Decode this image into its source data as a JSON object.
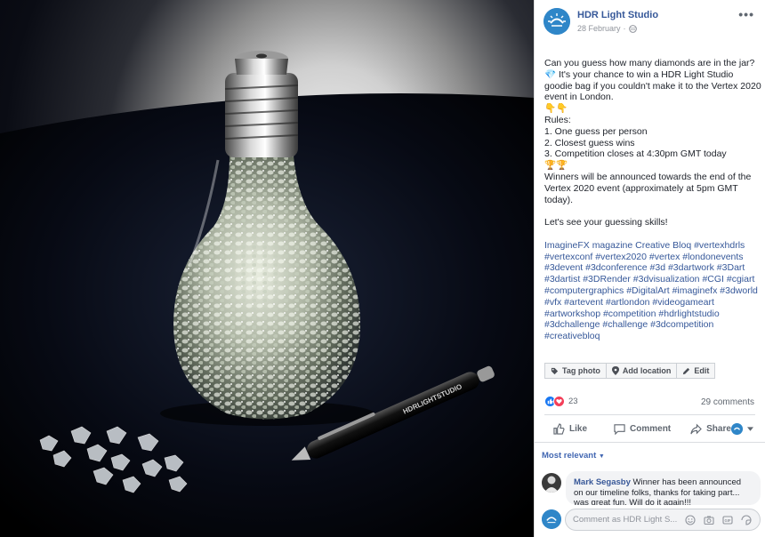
{
  "post": {
    "page_name": "HDR Light Studio",
    "date": "28 February",
    "body_lines": [
      {
        "text": "Can you guess how many diamonds are in the jar?",
        "kind": "text"
      },
      {
        "text": "💎 It's your chance to win a HDR Light Studio",
        "kind": "text"
      },
      {
        "text": "goodie bag if you couldn't make it to the Vertex 2020",
        "kind": "text"
      },
      {
        "text": "event in London.",
        "kind": "text"
      },
      {
        "text": "👇👇",
        "kind": "text"
      },
      {
        "text": "Rules:",
        "kind": "text"
      },
      {
        "text": "1. One guess per person",
        "kind": "text"
      },
      {
        "text": "2. Closest guess wins",
        "kind": "text"
      },
      {
        "text": "3. Competition closes at 4:30pm GMT today",
        "kind": "text"
      },
      {
        "text": "🏆🏆",
        "kind": "text"
      },
      {
        "text": "Winners will be announced towards the end of the",
        "kind": "text"
      },
      {
        "text": "Vertex 2020 event (approximately at 5pm GMT",
        "kind": "text"
      },
      {
        "text": "today).",
        "kind": "text"
      },
      {
        "text": "",
        "kind": "blank"
      },
      {
        "text": "Let's see your guessing skills!",
        "kind": "text"
      },
      {
        "text": "",
        "kind": "blank"
      },
      {
        "text": "ImagineFX magazine Creative Bloq #vertexhdrls",
        "kind": "tag"
      },
      {
        "text": "#vertexconf #vertex2020 #vertex #londonevents",
        "kind": "tag"
      },
      {
        "text": "#3devent #3dconference #3d #3dartwork #3Dart",
        "kind": "tag"
      },
      {
        "text": "#3dartist #3DRender #3dvisualization #CGI #cgiart",
        "kind": "tag"
      },
      {
        "text": "#computergraphics #DigitalArt #imaginefx #3dworld",
        "kind": "tag"
      },
      {
        "text": "#vfx #artevent #artlondon #videogameart",
        "kind": "tag"
      },
      {
        "text": "#artworkshop #competition #hdrlightstudio",
        "kind": "tag"
      },
      {
        "text": "#3dchallenge #challenge #3dcompetition",
        "kind": "tag"
      },
      {
        "text": "#creativebloq",
        "kind": "tag"
      }
    ]
  },
  "photo_actions": {
    "tag_photo": "Tag photo",
    "add_location": "Add location",
    "edit": "Edit"
  },
  "stats": {
    "reaction_count": "23",
    "comments_count": "29 comments"
  },
  "actions": {
    "like": "Like",
    "comment": "Comment",
    "share": "Share"
  },
  "sort_label": "Most relevant",
  "comment": {
    "author": "Mark Segasby",
    "text": "Winner has been announced on our timeline folks, thanks for taking part... was great fun. Will do it again!!!"
  },
  "composer": {
    "placeholder": "Comment as HDR Light S..."
  },
  "pen_brand": "HDRLIGHTSTUDIO",
  "colors": {
    "link": "#365899",
    "brand": "#2f86c8",
    "like": "#1877f2",
    "love": "#f33e58"
  }
}
